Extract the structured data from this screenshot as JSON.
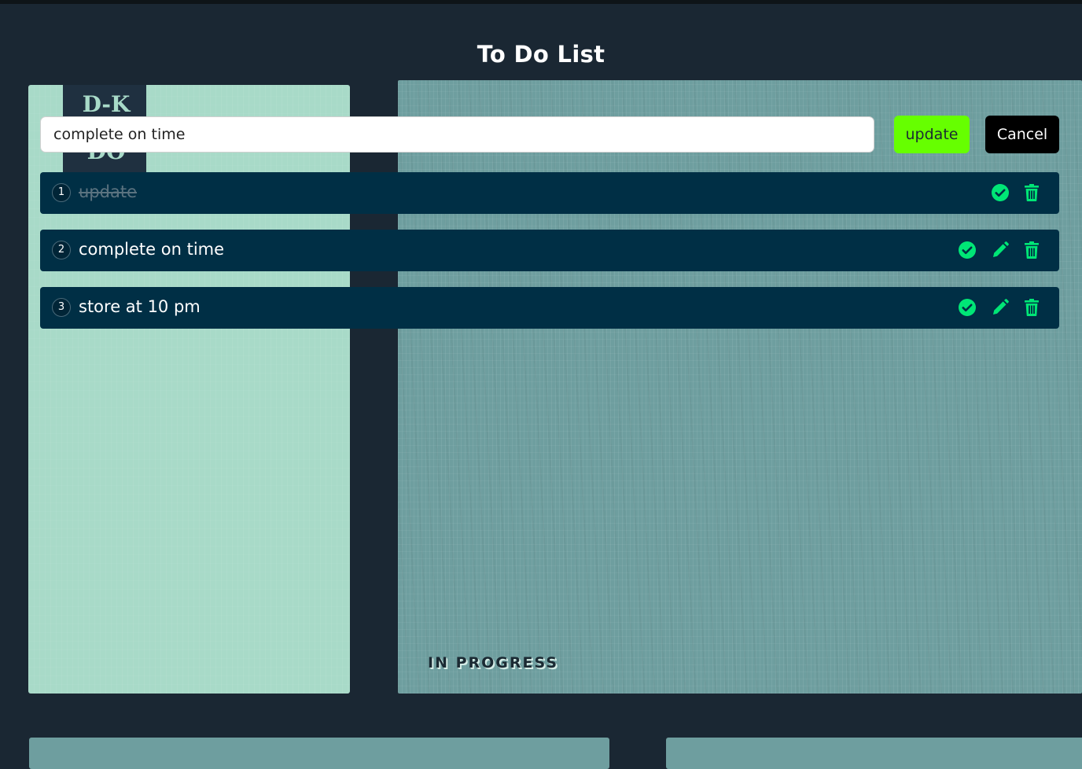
{
  "header": {
    "title": "To Do List"
  },
  "decor": {
    "poster_text": "D-K Lets DO",
    "panel_caption": "IN PROGRESS"
  },
  "form": {
    "input_value": "complete on time",
    "update_label": "update",
    "cancel_label": "Cancel"
  },
  "tasks": [
    {
      "number": "1",
      "text": "update",
      "completed": true
    },
    {
      "number": "2",
      "text": "complete on time",
      "completed": false
    },
    {
      "number": "3",
      "text": "store at 10 pm",
      "completed": false
    }
  ],
  "icons": {
    "complete": "check-circle-icon",
    "edit": "pencil-icon",
    "delete": "trash-icon"
  },
  "colors": {
    "background": "#1a2733",
    "row": "#002f45",
    "accent_green": "#66ff00",
    "icon_green": "#00e676",
    "cancel": "#000000"
  }
}
